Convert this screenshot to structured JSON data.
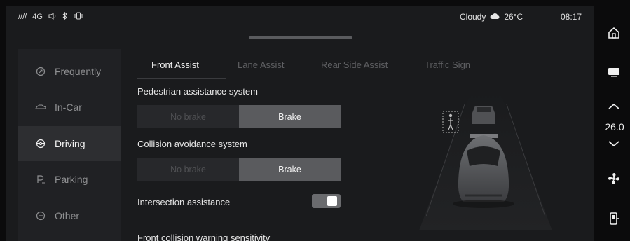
{
  "status": {
    "signal": "////",
    "network": "4G",
    "weather": "Cloudy",
    "temperature": "26°C",
    "time": "08:17"
  },
  "nav": {
    "items": [
      {
        "label": "Frequently",
        "icon": "frequently-icon",
        "active": false
      },
      {
        "label": "In-Car",
        "icon": "car-icon",
        "active": false
      },
      {
        "label": "Driving",
        "icon": "steering-wheel-icon",
        "active": true
      },
      {
        "label": "Parking",
        "icon": "parking-icon",
        "active": false
      },
      {
        "label": "Other",
        "icon": "other-icon",
        "active": false
      }
    ]
  },
  "tabs": [
    {
      "label": "Front Assist",
      "active": true
    },
    {
      "label": "Lane Assist",
      "active": false
    },
    {
      "label": "Rear Side Assist",
      "active": false
    },
    {
      "label": "Traffic Sign",
      "active": false
    }
  ],
  "settings": {
    "pedestrian": {
      "label": "Pedestrian assistance system",
      "options": [
        "No brake",
        "Brake"
      ],
      "selected": "Brake"
    },
    "collision": {
      "label": "Collision avoidance system",
      "options": [
        "No brake",
        "Brake"
      ],
      "selected": "Brake"
    },
    "intersection": {
      "label": "Intersection assistance",
      "enabled": true
    },
    "fcw": {
      "label": "Front collision warning sensitivity"
    }
  },
  "dock": {
    "climate_temp": "26.0",
    "icons": [
      "home-icon",
      "screen-icon",
      "temp-up-icon",
      "temp-down-icon",
      "fan-icon",
      "seat-icon"
    ]
  },
  "colors": {
    "panel": "#1a1b1d",
    "nav_active": "#2d2e31",
    "segment_on": "#5a5b5e",
    "segment_off": "#27282b"
  }
}
